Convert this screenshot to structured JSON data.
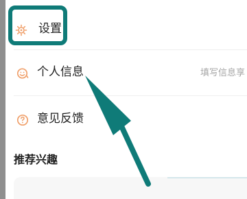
{
  "menu": {
    "settings": {
      "label": "设置",
      "icon": "settings-gear-icon"
    },
    "profile": {
      "label": "个人信息",
      "hint": "填写信息享",
      "icon": "face-icon"
    },
    "feedback": {
      "label": "意见反馈",
      "icon": "question-icon"
    }
  },
  "section": {
    "title": "推荐兴趣"
  },
  "colors": {
    "accent": "#0f7b78",
    "background": "#ffffff",
    "outer": "#8f8f8f"
  }
}
